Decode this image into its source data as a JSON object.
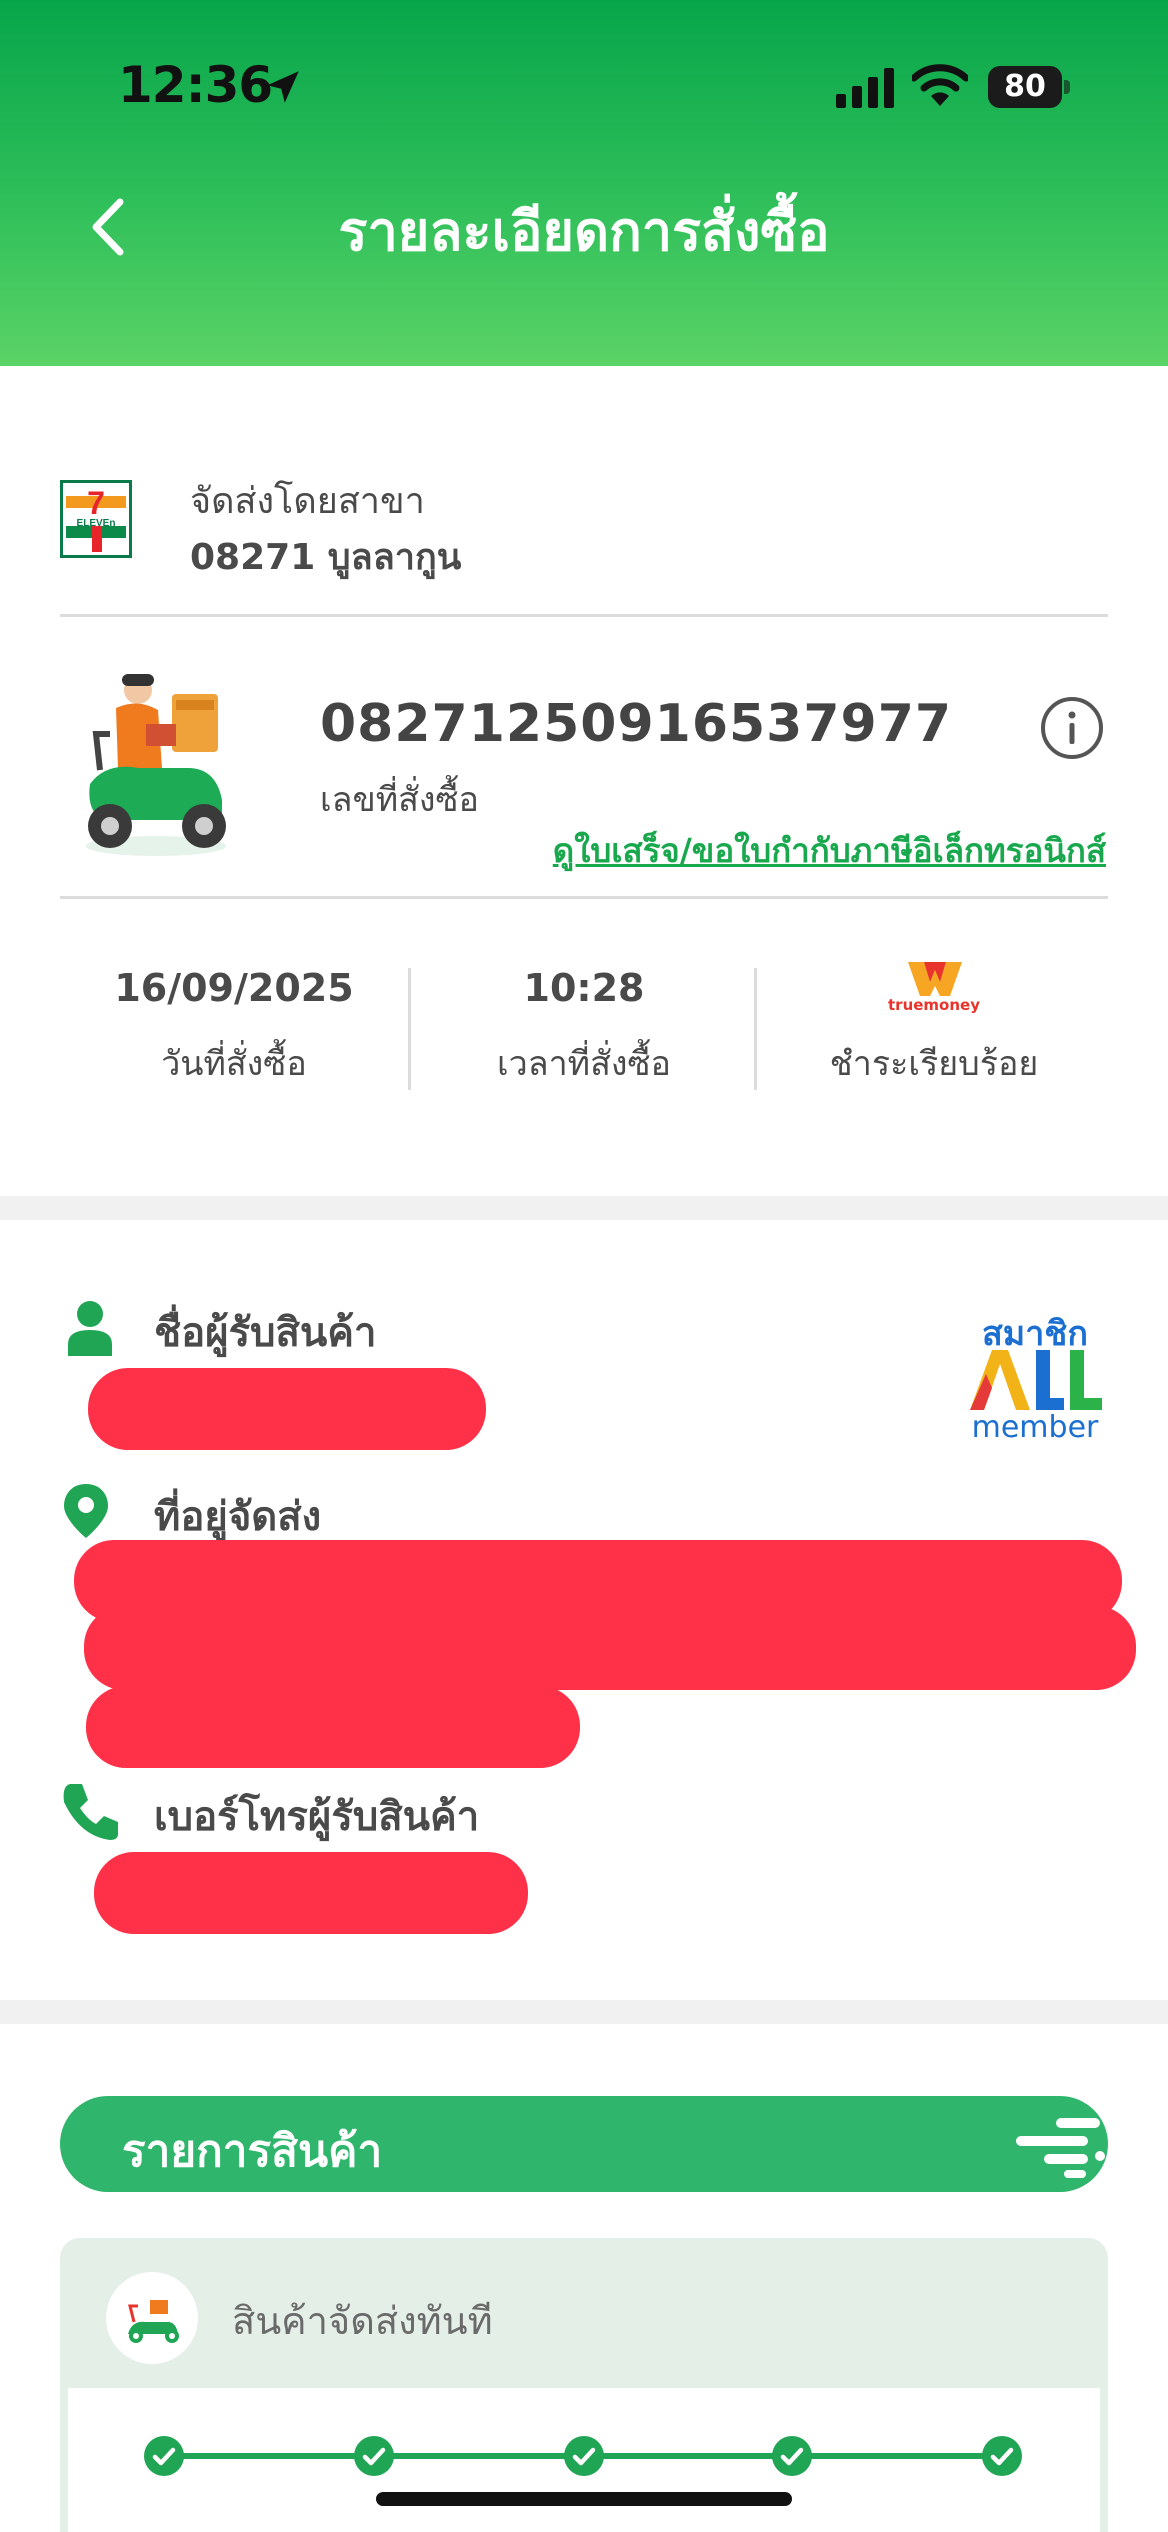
{
  "status_bar": {
    "time": "12:36",
    "battery": "80"
  },
  "header": {
    "title": "รายละเอียดการสั่งซื้อ"
  },
  "branch": {
    "label": "จัดส่งโดยสาขา",
    "name": "08271 บูลลากูน",
    "logo_text": "7 ELEVEn"
  },
  "order": {
    "number": "08271250916537977",
    "number_label": "เลขที่สั่งซื้อ",
    "receipt_link": "ดูใบเสร็จ/ขอใบกำกับภาษีอิเล็กทรอนิกส์"
  },
  "stats": {
    "date": "16/09/2025",
    "date_label": "วันที่สั่งซื้อ",
    "time": "10:28",
    "time_label": "เวลาที่สั่งซื้อ",
    "payment_brand": "truemoney",
    "payment_label": "ชำระเรียบร้อย"
  },
  "customer": {
    "name_label": "ชื่อผู้รับสินค้า",
    "address_label": "ที่อยู่จัดส่ง",
    "phone_label": "เบอร์โทรผู้รับสินค้า",
    "membership": {
      "top": "สมาชิก",
      "logo": "ALL",
      "bottom": "member"
    }
  },
  "products": {
    "section_title": "รายการสินค้า",
    "delivery_type": "สินค้าจัดส่งทันที",
    "steps_completed": 5
  },
  "colors": {
    "primary_green": "#1fa553",
    "header_green": "#07a54a",
    "redaction": "#fe3148",
    "link_green": "#1aa84f"
  }
}
